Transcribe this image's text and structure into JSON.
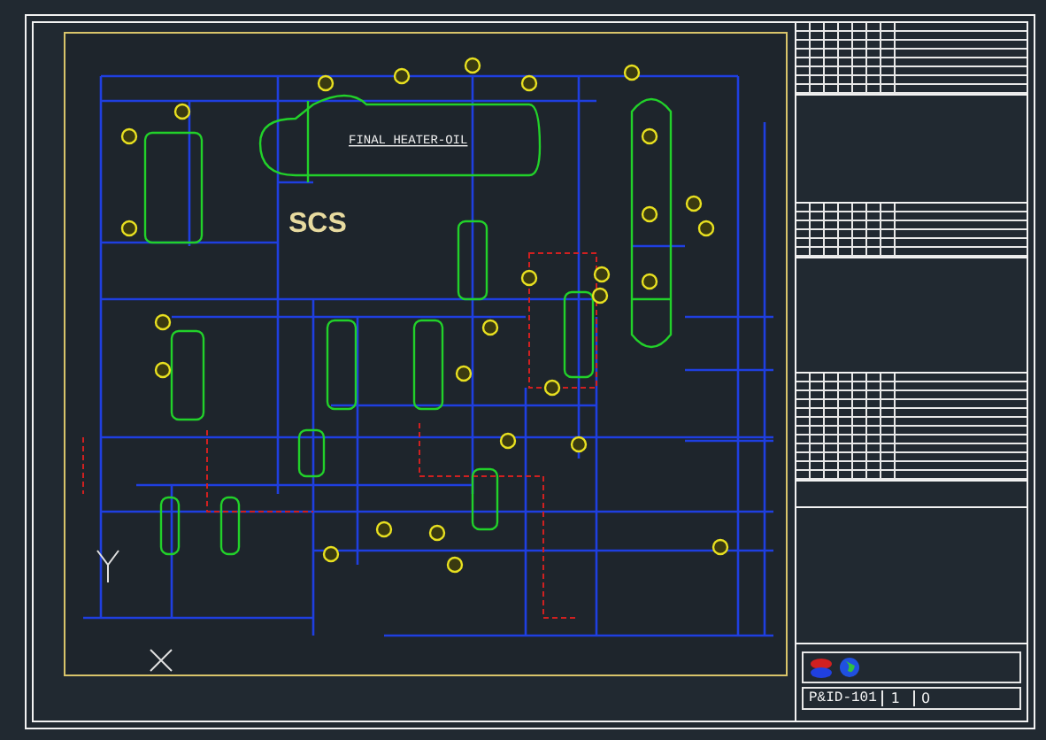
{
  "drawing": {
    "vessel_label": "FINAL HEATER-OIL",
    "watermark_logo": "SCS"
  },
  "title_block": {
    "drawing_number": "P&ID-101",
    "sheet": "1",
    "revision": "0"
  }
}
